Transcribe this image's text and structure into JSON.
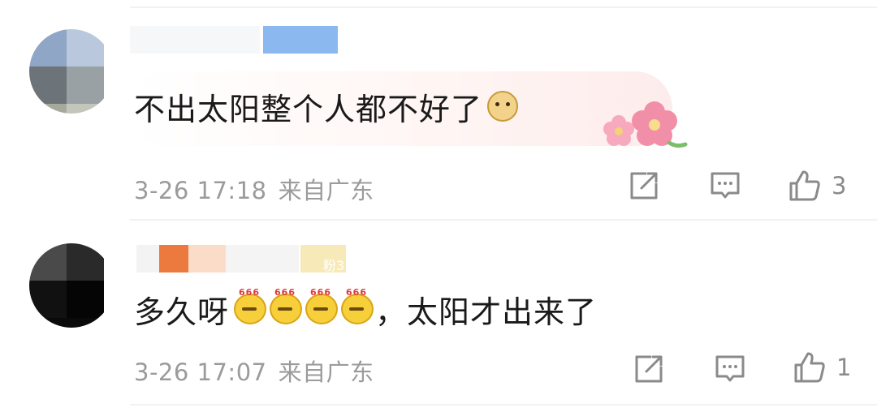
{
  "comments": [
    {
      "text": "不出太阳整个人都不好了",
      "emoji": "doge-emoji",
      "date": "3-26 17:18",
      "location": "来自广东",
      "likes": "3"
    },
    {
      "text_before": "多久呀",
      "emoji_count": 4,
      "emoji_label": "666",
      "text_after": "，太阳才出来了",
      "fan_badge": "粉3",
      "date": "3-26 17:07",
      "location": "来自广东",
      "likes": "1"
    }
  ],
  "icons": {
    "share": "share-icon",
    "comment": "comment-icon",
    "like": "thumbs-up-icon"
  },
  "colors": {
    "meta_text": "#9b9b9b",
    "body_text": "#1a1a1a",
    "bubble_tint": "#fdecec"
  }
}
